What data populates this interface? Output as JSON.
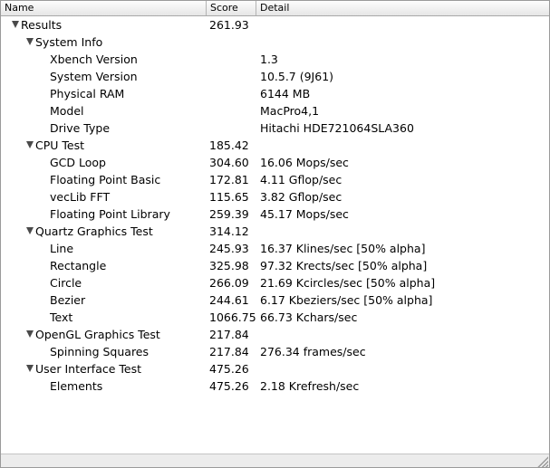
{
  "columns": {
    "name": "Name",
    "score": "Score",
    "detail": "Detail"
  },
  "rows": [
    {
      "name": "Results",
      "score": "261.93",
      "detail": "",
      "level": 0,
      "expandable": true
    },
    {
      "name": "System Info",
      "score": "",
      "detail": "",
      "level": 1,
      "expandable": true
    },
    {
      "name": "Xbench Version",
      "score": "",
      "detail": "1.3",
      "level": 2,
      "expandable": false
    },
    {
      "name": "System Version",
      "score": "",
      "detail": "10.5.7 (9J61)",
      "level": 2,
      "expandable": false
    },
    {
      "name": "Physical RAM",
      "score": "",
      "detail": "6144 MB",
      "level": 2,
      "expandable": false
    },
    {
      "name": "Model",
      "score": "",
      "detail": "MacPro4,1",
      "level": 2,
      "expandable": false
    },
    {
      "name": "Drive Type",
      "score": "",
      "detail": "Hitachi HDE721064SLA360",
      "level": 2,
      "expandable": false
    },
    {
      "name": "CPU Test",
      "score": "185.42",
      "detail": "",
      "level": 1,
      "expandable": true
    },
    {
      "name": "GCD Loop",
      "score": "304.60",
      "detail": "16.06 Mops/sec",
      "level": 2,
      "expandable": false
    },
    {
      "name": "Floating Point Basic",
      "score": "172.81",
      "detail": "4.11 Gflop/sec",
      "level": 2,
      "expandable": false
    },
    {
      "name": "vecLib FFT",
      "score": "115.65",
      "detail": "3.82 Gflop/sec",
      "level": 2,
      "expandable": false
    },
    {
      "name": "Floating Point Library",
      "score": "259.39",
      "detail": "45.17 Mops/sec",
      "level": 2,
      "expandable": false
    },
    {
      "name": "Quartz Graphics Test",
      "score": "314.12",
      "detail": "",
      "level": 1,
      "expandable": true
    },
    {
      "name": "Line",
      "score": "245.93",
      "detail": "16.37 Klines/sec [50% alpha]",
      "level": 2,
      "expandable": false
    },
    {
      "name": "Rectangle",
      "score": "325.98",
      "detail": "97.32 Krects/sec [50% alpha]",
      "level": 2,
      "expandable": false
    },
    {
      "name": "Circle",
      "score": "266.09",
      "detail": "21.69 Kcircles/sec [50% alpha]",
      "level": 2,
      "expandable": false
    },
    {
      "name": "Bezier",
      "score": "244.61",
      "detail": "6.17 Kbeziers/sec [50% alpha]",
      "level": 2,
      "expandable": false
    },
    {
      "name": "Text",
      "score": "1066.75",
      "detail": "66.73 Kchars/sec",
      "level": 2,
      "expandable": false
    },
    {
      "name": "OpenGL Graphics Test",
      "score": "217.84",
      "detail": "",
      "level": 1,
      "expandable": true
    },
    {
      "name": "Spinning Squares",
      "score": "217.84",
      "detail": "276.34 frames/sec",
      "level": 2,
      "expandable": false
    },
    {
      "name": "User Interface Test",
      "score": "475.26",
      "detail": "",
      "level": 1,
      "expandable": true
    },
    {
      "name": "Elements",
      "score": "475.26",
      "detail": "2.18 Krefresh/sec",
      "level": 2,
      "expandable": false
    }
  ],
  "icons": {
    "disclosure": "disclosure-triangle-down-icon",
    "resize": "resize-grip-icon"
  }
}
